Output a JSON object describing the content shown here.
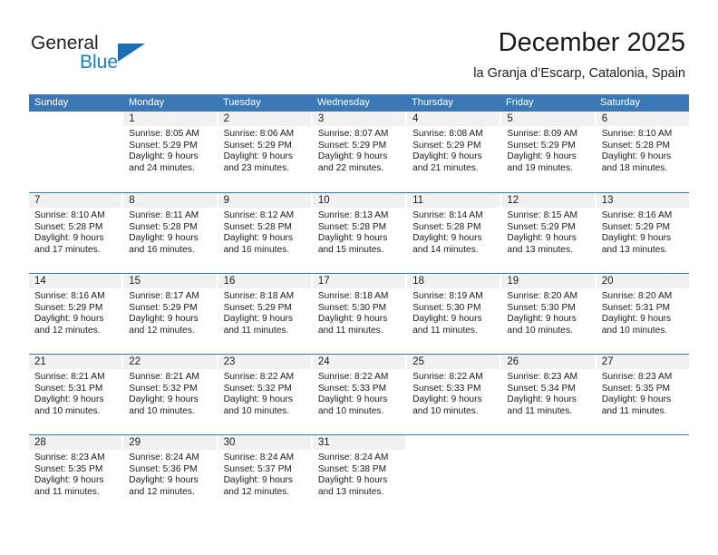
{
  "brand": {
    "name_top": "General",
    "name_bottom": "Blue",
    "accent_color": "#1a6fb5"
  },
  "header": {
    "title": "December 2025",
    "subtitle": "la Granja d’Escarp, Catalonia, Spain"
  },
  "calendar": {
    "header_color": "#3b78b5",
    "weekdays": [
      "Sunday",
      "Monday",
      "Tuesday",
      "Wednesday",
      "Thursday",
      "Friday",
      "Saturday"
    ],
    "weeks": [
      [
        {
          "day": "",
          "sunrise": "",
          "sunset": "",
          "daylight1": "",
          "daylight2": ""
        },
        {
          "day": "1",
          "sunrise": "Sunrise: 8:05 AM",
          "sunset": "Sunset: 5:29 PM",
          "daylight1": "Daylight: 9 hours",
          "daylight2": "and 24 minutes."
        },
        {
          "day": "2",
          "sunrise": "Sunrise: 8:06 AM",
          "sunset": "Sunset: 5:29 PM",
          "daylight1": "Daylight: 9 hours",
          "daylight2": "and 23 minutes."
        },
        {
          "day": "3",
          "sunrise": "Sunrise: 8:07 AM",
          "sunset": "Sunset: 5:29 PM",
          "daylight1": "Daylight: 9 hours",
          "daylight2": "and 22 minutes."
        },
        {
          "day": "4",
          "sunrise": "Sunrise: 8:08 AM",
          "sunset": "Sunset: 5:29 PM",
          "daylight1": "Daylight: 9 hours",
          "daylight2": "and 21 minutes."
        },
        {
          "day": "5",
          "sunrise": "Sunrise: 8:09 AM",
          "sunset": "Sunset: 5:29 PM",
          "daylight1": "Daylight: 9 hours",
          "daylight2": "and 19 minutes."
        },
        {
          "day": "6",
          "sunrise": "Sunrise: 8:10 AM",
          "sunset": "Sunset: 5:28 PM",
          "daylight1": "Daylight: 9 hours",
          "daylight2": "and 18 minutes."
        }
      ],
      [
        {
          "day": "7",
          "sunrise": "Sunrise: 8:10 AM",
          "sunset": "Sunset: 5:28 PM",
          "daylight1": "Daylight: 9 hours",
          "daylight2": "and 17 minutes."
        },
        {
          "day": "8",
          "sunrise": "Sunrise: 8:11 AM",
          "sunset": "Sunset: 5:28 PM",
          "daylight1": "Daylight: 9 hours",
          "daylight2": "and 16 minutes."
        },
        {
          "day": "9",
          "sunrise": "Sunrise: 8:12 AM",
          "sunset": "Sunset: 5:28 PM",
          "daylight1": "Daylight: 9 hours",
          "daylight2": "and 16 minutes."
        },
        {
          "day": "10",
          "sunrise": "Sunrise: 8:13 AM",
          "sunset": "Sunset: 5:28 PM",
          "daylight1": "Daylight: 9 hours",
          "daylight2": "and 15 minutes."
        },
        {
          "day": "11",
          "sunrise": "Sunrise: 8:14 AM",
          "sunset": "Sunset: 5:28 PM",
          "daylight1": "Daylight: 9 hours",
          "daylight2": "and 14 minutes."
        },
        {
          "day": "12",
          "sunrise": "Sunrise: 8:15 AM",
          "sunset": "Sunset: 5:29 PM",
          "daylight1": "Daylight: 9 hours",
          "daylight2": "and 13 minutes."
        },
        {
          "day": "13",
          "sunrise": "Sunrise: 8:16 AM",
          "sunset": "Sunset: 5:29 PM",
          "daylight1": "Daylight: 9 hours",
          "daylight2": "and 13 minutes."
        }
      ],
      [
        {
          "day": "14",
          "sunrise": "Sunrise: 8:16 AM",
          "sunset": "Sunset: 5:29 PM",
          "daylight1": "Daylight: 9 hours",
          "daylight2": "and 12 minutes."
        },
        {
          "day": "15",
          "sunrise": "Sunrise: 8:17 AM",
          "sunset": "Sunset: 5:29 PM",
          "daylight1": "Daylight: 9 hours",
          "daylight2": "and 12 minutes."
        },
        {
          "day": "16",
          "sunrise": "Sunrise: 8:18 AM",
          "sunset": "Sunset: 5:29 PM",
          "daylight1": "Daylight: 9 hours",
          "daylight2": "and 11 minutes."
        },
        {
          "day": "17",
          "sunrise": "Sunrise: 8:18 AM",
          "sunset": "Sunset: 5:30 PM",
          "daylight1": "Daylight: 9 hours",
          "daylight2": "and 11 minutes."
        },
        {
          "day": "18",
          "sunrise": "Sunrise: 8:19 AM",
          "sunset": "Sunset: 5:30 PM",
          "daylight1": "Daylight: 9 hours",
          "daylight2": "and 11 minutes."
        },
        {
          "day": "19",
          "sunrise": "Sunrise: 8:20 AM",
          "sunset": "Sunset: 5:30 PM",
          "daylight1": "Daylight: 9 hours",
          "daylight2": "and 10 minutes."
        },
        {
          "day": "20",
          "sunrise": "Sunrise: 8:20 AM",
          "sunset": "Sunset: 5:31 PM",
          "daylight1": "Daylight: 9 hours",
          "daylight2": "and 10 minutes."
        }
      ],
      [
        {
          "day": "21",
          "sunrise": "Sunrise: 8:21 AM",
          "sunset": "Sunset: 5:31 PM",
          "daylight1": "Daylight: 9 hours",
          "daylight2": "and 10 minutes."
        },
        {
          "day": "22",
          "sunrise": "Sunrise: 8:21 AM",
          "sunset": "Sunset: 5:32 PM",
          "daylight1": "Daylight: 9 hours",
          "daylight2": "and 10 minutes."
        },
        {
          "day": "23",
          "sunrise": "Sunrise: 8:22 AM",
          "sunset": "Sunset: 5:32 PM",
          "daylight1": "Daylight: 9 hours",
          "daylight2": "and 10 minutes."
        },
        {
          "day": "24",
          "sunrise": "Sunrise: 8:22 AM",
          "sunset": "Sunset: 5:33 PM",
          "daylight1": "Daylight: 9 hours",
          "daylight2": "and 10 minutes."
        },
        {
          "day": "25",
          "sunrise": "Sunrise: 8:22 AM",
          "sunset": "Sunset: 5:33 PM",
          "daylight1": "Daylight: 9 hours",
          "daylight2": "and 10 minutes."
        },
        {
          "day": "26",
          "sunrise": "Sunrise: 8:23 AM",
          "sunset": "Sunset: 5:34 PM",
          "daylight1": "Daylight: 9 hours",
          "daylight2": "and 11 minutes."
        },
        {
          "day": "27",
          "sunrise": "Sunrise: 8:23 AM",
          "sunset": "Sunset: 5:35 PM",
          "daylight1": "Daylight: 9 hours",
          "daylight2": "and 11 minutes."
        }
      ],
      [
        {
          "day": "28",
          "sunrise": "Sunrise: 8:23 AM",
          "sunset": "Sunset: 5:35 PM",
          "daylight1": "Daylight: 9 hours",
          "daylight2": "and 11 minutes."
        },
        {
          "day": "29",
          "sunrise": "Sunrise: 8:24 AM",
          "sunset": "Sunset: 5:36 PM",
          "daylight1": "Daylight: 9 hours",
          "daylight2": "and 12 minutes."
        },
        {
          "day": "30",
          "sunrise": "Sunrise: 8:24 AM",
          "sunset": "Sunset: 5:37 PM",
          "daylight1": "Daylight: 9 hours",
          "daylight2": "and 12 minutes."
        },
        {
          "day": "31",
          "sunrise": "Sunrise: 8:24 AM",
          "sunset": "Sunset: 5:38 PM",
          "daylight1": "Daylight: 9 hours",
          "daylight2": "and 13 minutes."
        },
        {
          "day": "",
          "sunrise": "",
          "sunset": "",
          "daylight1": "",
          "daylight2": ""
        },
        {
          "day": "",
          "sunrise": "",
          "sunset": "",
          "daylight1": "",
          "daylight2": ""
        },
        {
          "day": "",
          "sunrise": "",
          "sunset": "",
          "daylight1": "",
          "daylight2": ""
        }
      ]
    ]
  }
}
